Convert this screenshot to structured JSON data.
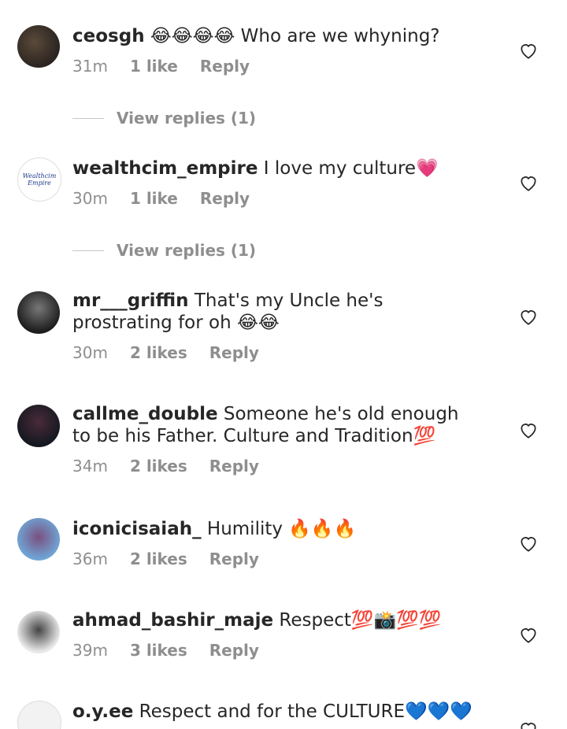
{
  "comments": [
    {
      "user": "ceosgh",
      "text": "😂😂😂😂 Who are we whyning?",
      "time": "31m",
      "likes": "1 like",
      "reply": "Reply",
      "view_replies": "View replies (1)"
    },
    {
      "user": "wealthcim_empire",
      "text": "I love my culture💗",
      "time": "30m",
      "likes": "1 like",
      "reply": "Reply",
      "view_replies": "View replies (1)",
      "avatar_text": "Wealthcim Empire"
    },
    {
      "user": "mr___griffin",
      "text": "That's my Uncle he's prostrating for oh 😂😂",
      "time": "30m",
      "likes": "2 likes",
      "reply": "Reply"
    },
    {
      "user": "callme_double",
      "text": "Someone he's old enough to be his Father. Culture and Tradition💯",
      "time": "34m",
      "likes": "2 likes",
      "reply": "Reply"
    },
    {
      "user": "iconicisaiah_",
      "text": "Humility 🔥🔥🔥",
      "time": "36m",
      "likes": "2 likes",
      "reply": "Reply"
    },
    {
      "user": "ahmad_bashir_maje",
      "text": "Respect💯📸💯💯",
      "time": "39m",
      "likes": "3 likes",
      "reply": "Reply"
    },
    {
      "user": "o.y.ee",
      "text": "Respect and for the CULTURE💙💙💙",
      "time": "",
      "likes": "",
      "reply": ""
    }
  ],
  "colors": {
    "primary_text": "#262626",
    "secondary_text": "#8e8e8e",
    "background": "#ffffff"
  }
}
